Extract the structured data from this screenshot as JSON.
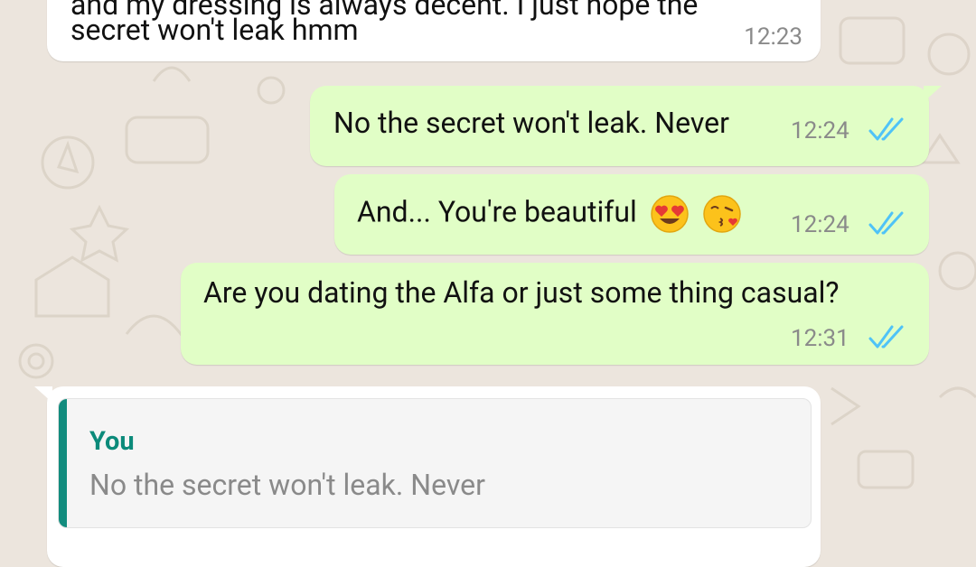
{
  "messages": [
    {
      "direction": "incoming",
      "text_line1": "and my dressing is always decent. I just hope the",
      "text_line2": "secret won't leak hmm",
      "time": "12:23"
    },
    {
      "direction": "outgoing",
      "text": "No the secret won't leak. Never",
      "time": "12:24",
      "status": "read"
    },
    {
      "direction": "outgoing",
      "text": "And... You're beautiful",
      "emojis": [
        "heart-eyes-emoji",
        "kissing-heart-emoji"
      ],
      "time": "12:24",
      "status": "read"
    },
    {
      "direction": "outgoing",
      "text": "Are you dating the Alfa or just some thing casual?",
      "time": "12:31",
      "status": "read"
    },
    {
      "direction": "incoming",
      "reply_to": {
        "sender": "You",
        "text": "No the secret won't leak. Never"
      }
    }
  ],
  "colors": {
    "background": "#ece5dd",
    "outgoing_bubble": "#e1fec6",
    "incoming_bubble": "#ffffff",
    "read_ticks": "#4fc3f7",
    "quote_accent": "#128c7e"
  }
}
